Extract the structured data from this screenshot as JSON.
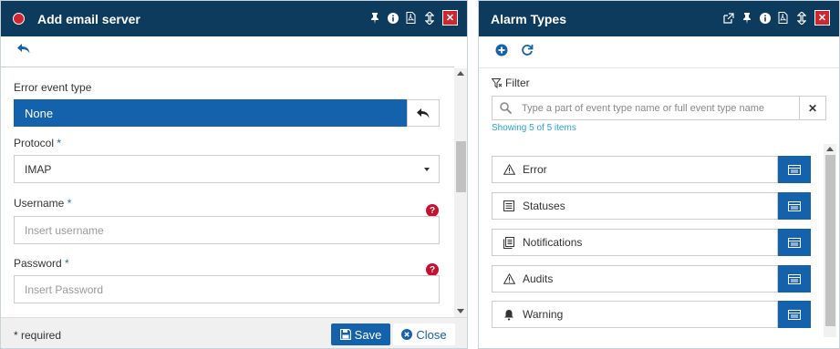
{
  "left_panel": {
    "title": "Add email server",
    "fields": {
      "error_event_type": {
        "label": "Error event type",
        "value": "None"
      },
      "protocol": {
        "label": "Protocol",
        "required_mark": "*",
        "value": "IMAP"
      },
      "username": {
        "label": "Username",
        "required_mark": "*",
        "placeholder": "Insert username",
        "help": "?"
      },
      "password": {
        "label": "Password",
        "required_mark": "*",
        "placeholder": "Insert Password",
        "help": "?"
      }
    },
    "footer": {
      "required_note": "* required",
      "save_label": "Save",
      "close_label": "Close"
    }
  },
  "right_panel": {
    "title": "Alarm Types",
    "filter_label": "Filter",
    "search_placeholder": "Type a part of event type name or full event type name",
    "clear_label": "✕",
    "showing": "Showing 5 of 5 items",
    "items": [
      {
        "label": "Error",
        "icon": "warning-icon"
      },
      {
        "label": "Statuses",
        "icon": "list-icon"
      },
      {
        "label": "Notifications",
        "icon": "notes-icon"
      },
      {
        "label": "Audits",
        "icon": "warning-icon"
      },
      {
        "label": "Warning",
        "icon": "bell-icon"
      }
    ]
  },
  "colors": {
    "titlebar": "#0d3b5e",
    "primary": "#1462ac",
    "close_red": "#d0262f",
    "help_red": "#c8102e",
    "link_blue": "#2a9fd6"
  }
}
